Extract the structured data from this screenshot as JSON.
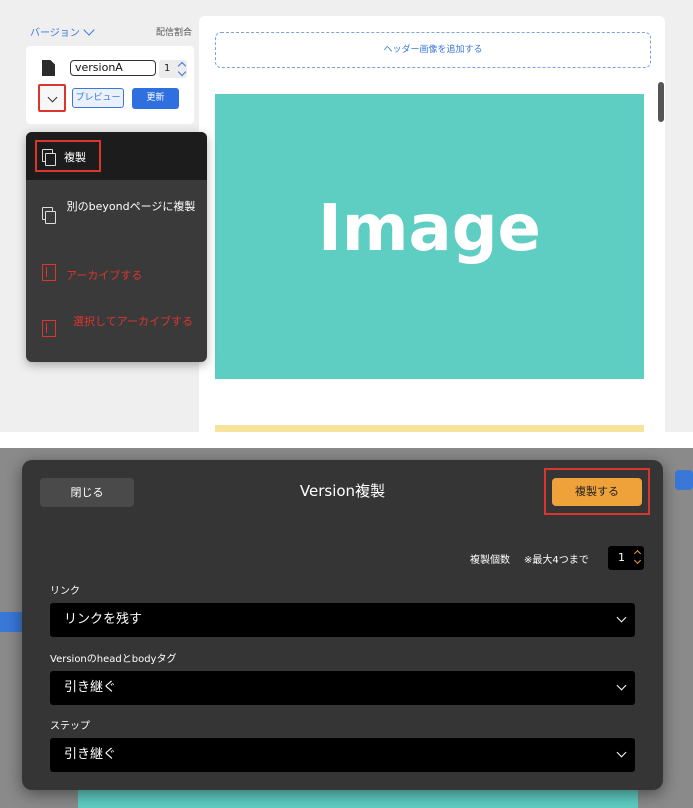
{
  "editor": {
    "version_label": "バージョン",
    "distribution_label": "配信割合",
    "version_name": "versionA",
    "version_number": "1",
    "preview_label": "プレビュー",
    "update_label": "更新",
    "add_header_label": "ヘッダー画像を追加する",
    "image_placeholder": "Image"
  },
  "menu": {
    "items": [
      {
        "label": "複製",
        "icon": "copy-icon"
      },
      {
        "label": "別のbeyondページに複製",
        "icon": "copy-icon"
      },
      {
        "label": "アーカイブする",
        "icon": "archive-icon"
      },
      {
        "label": "選択してアーカイブする",
        "icon": "archive-icon"
      }
    ]
  },
  "dialog": {
    "close_label": "閉じる",
    "title": "Version複製",
    "duplicate_label": "複製する",
    "count_label": "複製個数",
    "count_note": "※最大4つまで",
    "count_value": "1",
    "fields": [
      {
        "label": "リンク",
        "value": "リンクを残す"
      },
      {
        "label": "Versionのheadとbodyタグ",
        "value": "引き継ぐ"
      },
      {
        "label": "ステップ",
        "value": "引き継ぐ"
      }
    ]
  },
  "colors": {
    "accent_blue": "#3a78d8",
    "danger_red": "#d9362f",
    "primary_orange": "#f0a23a",
    "image_teal": "#5ecdc2"
  }
}
